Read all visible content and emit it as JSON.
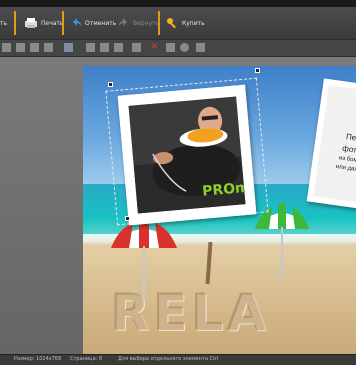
{
  "toolbar": {
    "print_label": "Печать",
    "undo_label": "Отменить",
    "redo_label": "Вернуть",
    "buy_label": "Купить"
  },
  "iconbar": {
    "icons": [
      "align-left-icon",
      "align-center-icon",
      "align-right-icon",
      "align-top-icon",
      "align-middle-icon",
      "align-bottom-icon",
      "distribute-h-icon",
      "distribute-v-icon",
      "bring-front-icon",
      "send-back-icon",
      "delete-icon",
      "copy-icon",
      "settings-icon",
      "lock-icon"
    ]
  },
  "canvas": {
    "watermark": "PROmo",
    "postcard_lines": [
      "Пере",
      "фото",
      "из бомо",
      "или даже"
    ],
    "sand_text": "RELA"
  },
  "status": {
    "size": "Размер: 1024x768",
    "page": "Страница: 8",
    "hint": "Для выбора отдельного элемента Ctrl"
  },
  "colors": {
    "accent": "#e39a1d",
    "umbrella_red": "#d8322a",
    "umbrella_green": "#3fb83a"
  }
}
